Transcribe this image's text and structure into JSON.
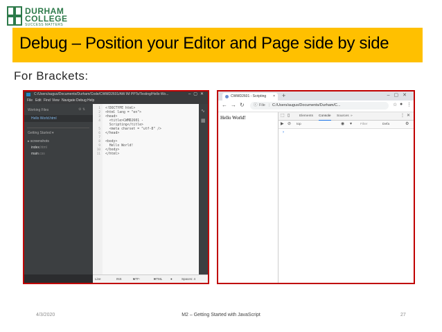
{
  "logo": {
    "line1": "DURHAM",
    "line2": "COLLEGE",
    "tagline": "SUCCESS MATTERS",
    "color": "#2d7a4a"
  },
  "slide": {
    "title": "Debug – Position your Editor and Page side by side",
    "title_bg": "#ffc000",
    "subtitle": "For Brackets:",
    "frame_color": "#c00000"
  },
  "brackets": {
    "window_title": "C:/Users/augus/Documents/Durham/Code/CWMD2601/AW IM PPTs/Testing/Hello Wo...",
    "menu": [
      "File",
      "Edit",
      "Find",
      "View",
      "Navigate",
      "Debug",
      "Help"
    ],
    "sidebar": {
      "working_files_label": "Working Files",
      "active_file": "Hello World.html",
      "getting_started": "Getting Started",
      "folder": "screenshots",
      "files": [
        {
          "name": "index",
          "ext": ".html"
        },
        {
          "name": "main",
          "ext": ".css"
        }
      ]
    },
    "line_numbers": [
      "1",
      "2",
      "3",
      "4",
      "",
      "5",
      "6",
      "7",
      "8",
      "9",
      "10",
      "11"
    ],
    "code_lines": [
      "<!DOCTYPE html>",
      "<html lang = \"en\">",
      "<head>",
      "  <title>CWMD2601 -",
      "  Scripting</title>",
      "  <meta charset = \"utf-8\" />",
      "</head>",
      "",
      "<body>",
      "  Hello World!",
      "</body>",
      "</html>"
    ],
    "status": {
      "line": "Line",
      "ins": "INS",
      "encoding": "UTF-8",
      "mode": "HTML",
      "spaces": "Spaces: 4"
    }
  },
  "browser": {
    "tab_title": "CWMD2601 - Scripting",
    "tab_close": "×",
    "new_tab": "+",
    "url_prefix": "File",
    "url": "C:/Users/augus/Documents/Durham/C...",
    "page_text": "Hello World!",
    "devtools_tabs": [
      "Elements",
      "Console",
      "Sources",
      "»"
    ],
    "active_tab": "Console",
    "context": "top",
    "filter": "Filter",
    "levels": "Defa",
    "prompt": "›"
  },
  "footer": {
    "date": "4/3/2020",
    "center": "M2 – Getting Started with JavaScript",
    "page": "27"
  }
}
